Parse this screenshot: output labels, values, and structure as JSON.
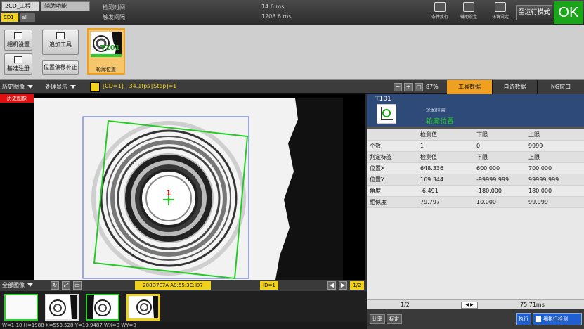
{
  "topbar": {
    "menu1": "2CD_工程00",
    "menu2": "辅助功能",
    "cam_tab1": "CD1",
    "cam_tab2": "all",
    "label_detect_time": "检测时间",
    "label_trigger_interval": "触发间隔",
    "value_detect_time": "14.6 ms",
    "value_trigger_interval": "1208.6 ms",
    "icons": [
      {
        "name": "execute-condition-icon",
        "label": "条件执行"
      },
      {
        "name": "aux-settings-icon",
        "label": "辅助设定"
      },
      {
        "name": "env-settings-icon",
        "label": "环境设定"
      }
    ],
    "run_mode_button": "至运行模式",
    "ok_status": "OK"
  },
  "toolstrip": {
    "camera_settings": "相机设置",
    "reference_register": "基准注册",
    "add_tool": "追加工具",
    "position_offset": "位置偏移补正",
    "tool_card_label": "轮廓位置",
    "tool_card_id": "T101"
  },
  "viewbar": {
    "history_select": "历史图像",
    "process_select": "处理显示",
    "cd_info": "[CD=1] : 34.1fps",
    "step_info": "[Step]=1",
    "zoom_percent": "87%",
    "tabs": [
      "工具数据",
      "自选数据",
      "NG窗口"
    ]
  },
  "image": {
    "history_badge": "历史图像",
    "marker_label": "1"
  },
  "image_footer": {
    "all_images_select": "全部图像",
    "hash_info": "208D7E7A A9:55:3C:ID7",
    "id_info": "ID=1",
    "page_info": "1/2"
  },
  "status": {
    "text": "W=1:10 H=1988 X=553.528 Y=19.9487 WX=0 WY=0"
  },
  "panel": {
    "tool_id": "T101",
    "tool_type": "轮廓位置",
    "tool_name": "轮廓位置",
    "columns": [
      "",
      "检测值",
      "下限",
      "上限"
    ],
    "rows": [
      [
        "个数",
        "1",
        "0",
        "9999"
      ],
      [
        "判定标签",
        "检测值",
        "下限",
        "上限"
      ],
      [
        "位置X",
        "648.336",
        "600.000",
        "700.000"
      ],
      [
        "位置Y",
        "169.344",
        "-99999.999",
        "99999.999"
      ],
      [
        "角度",
        "-6.491",
        "-180.000",
        "180.000"
      ],
      [
        "相似度",
        "79.797",
        "10.000",
        "99.999"
      ]
    ],
    "page": "1/2",
    "time": "75.71ms",
    "btn_compare": "比率",
    "btn_calib": "标定",
    "btn_execute": "执行",
    "btn_run_detect": "细执行检测"
  }
}
